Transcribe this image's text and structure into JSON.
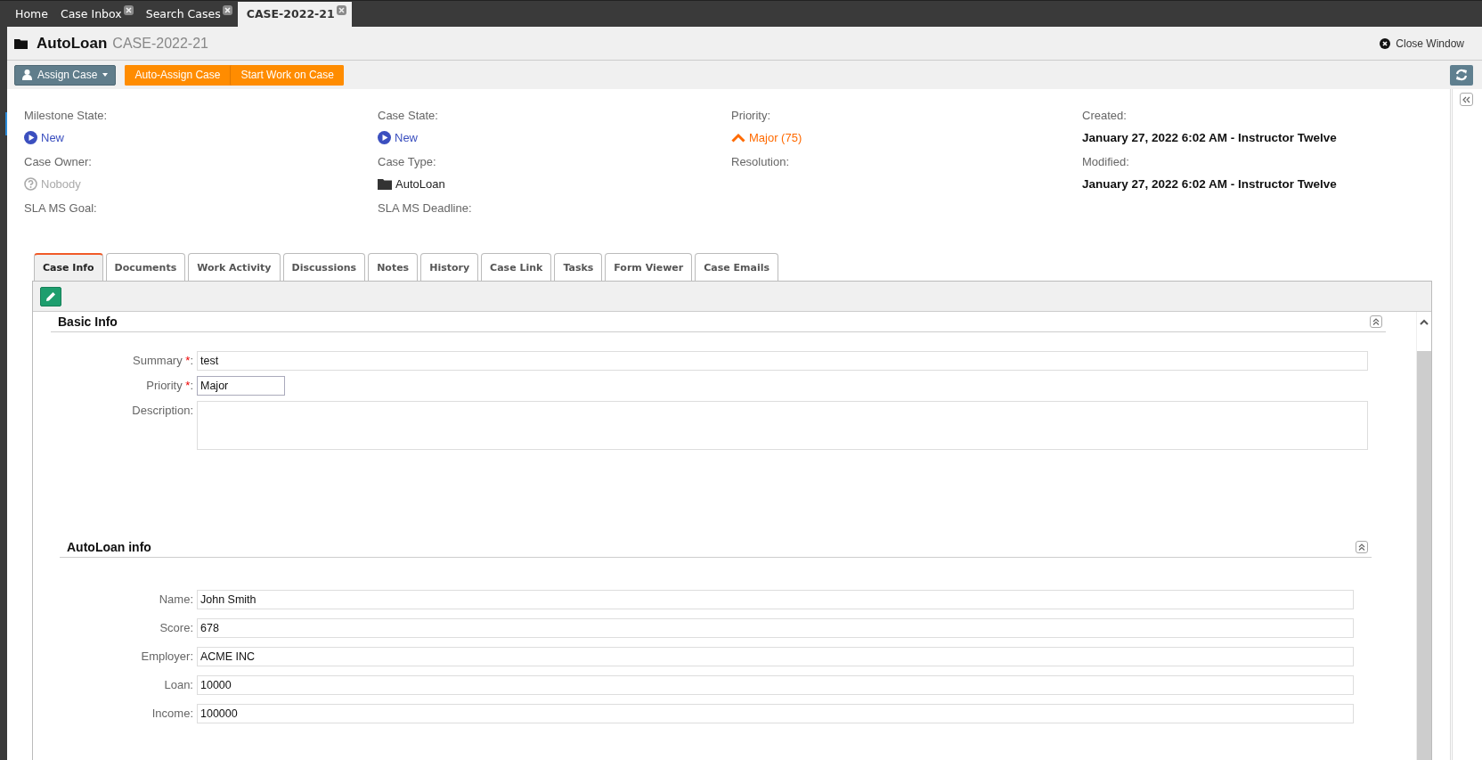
{
  "top_tabs": [
    {
      "label": "Home",
      "closable": false,
      "selected": false
    },
    {
      "label": "Case Inbox",
      "closable": true,
      "selected": false
    },
    {
      "label": "Search Cases",
      "closable": true,
      "selected": false
    },
    {
      "label": "CASE-2022-21",
      "closable": true,
      "selected": true
    }
  ],
  "header": {
    "title": "AutoLoan",
    "case_number": "CASE-2022-21",
    "close_label": "Close Window"
  },
  "toolbar": {
    "assign_label": "Assign Case",
    "actions": [
      "Auto-Assign Case",
      "Start Work on Case"
    ]
  },
  "info": [
    {
      "label": "Milestone State:",
      "value": "New",
      "kind": "state"
    },
    {
      "label": "Case State:",
      "value": "New",
      "kind": "state"
    },
    {
      "label": "Priority:",
      "value": "Major (75)",
      "kind": "priority"
    },
    {
      "label": "Created:",
      "value": "January 27, 2022 6:02 AM - Instructor Twelve",
      "kind": "bold"
    },
    {
      "label": "Case Owner:",
      "value": "Nobody",
      "kind": "unknown"
    },
    {
      "label": "Case Type:",
      "value": "AutoLoan",
      "kind": "type"
    },
    {
      "label": "Resolution:",
      "kind": "empty"
    },
    {
      "label": "Modified:",
      "value": "January 27, 2022 6:02 AM - Instructor Twelve",
      "kind": "bold"
    },
    {
      "label": "SLA MS Goal:",
      "kind": "empty"
    },
    {
      "label": "SLA MS Deadline:",
      "kind": "empty"
    }
  ],
  "case_tabs": [
    {
      "label": "Case Info",
      "selected": true
    },
    {
      "label": "Documents",
      "selected": false
    },
    {
      "label": "Work Activity",
      "selected": false
    },
    {
      "label": "Discussions",
      "selected": false
    },
    {
      "label": "Notes",
      "selected": false
    },
    {
      "label": "History",
      "selected": false
    },
    {
      "label": "Case Link",
      "selected": false
    },
    {
      "label": "Tasks",
      "selected": false
    },
    {
      "label": "Form Viewer",
      "selected": false
    },
    {
      "label": "Case Emails",
      "selected": false
    }
  ],
  "sections": [
    {
      "title": "Basic Info",
      "fields": [
        {
          "label": "Summary",
          "required_mark": "*",
          "separator": ":",
          "value": "test",
          "kind": "text"
        },
        {
          "label": "Priority",
          "required_mark": "*",
          "separator": ":",
          "value": "Major",
          "kind": "short"
        },
        {
          "label": "Description",
          "separator": ":",
          "kind": "textarea"
        }
      ]
    },
    {
      "title": "AutoLoan info",
      "fields": [
        {
          "label": "Name",
          "separator": ":",
          "value": "John Smith",
          "kind": "text"
        },
        {
          "label": "Score",
          "separator": ":",
          "value": "678",
          "kind": "text"
        },
        {
          "label": "Employer",
          "separator": ":",
          "value": "ACME INC",
          "kind": "text"
        },
        {
          "label": "Loan",
          "separator": ":",
          "value": "10000",
          "kind": "text"
        },
        {
          "label": "Income",
          "separator": ":",
          "value": "100000",
          "kind": "text"
        }
      ]
    }
  ]
}
